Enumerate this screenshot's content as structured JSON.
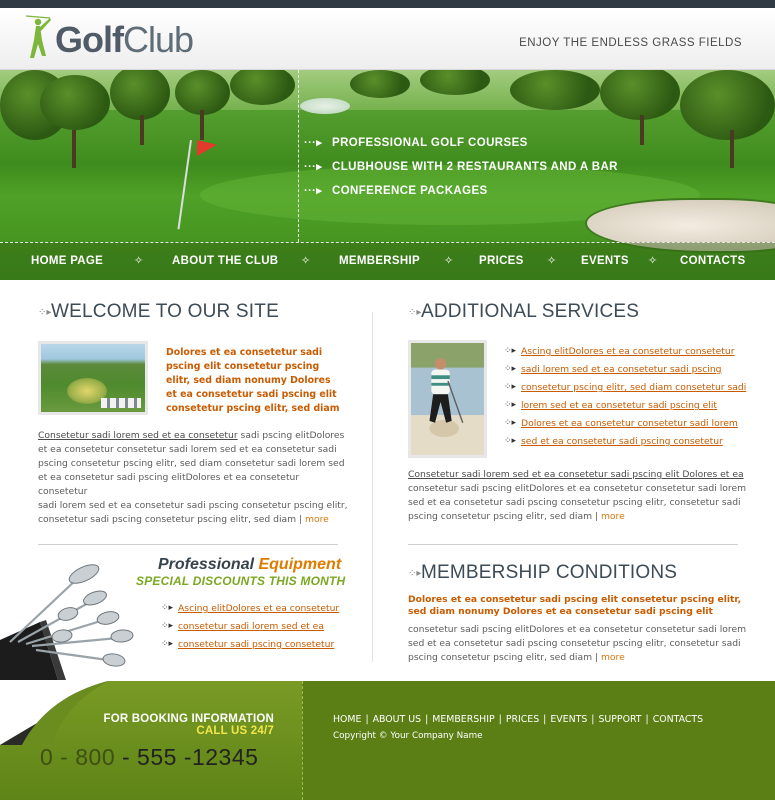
{
  "header": {
    "logo_part1": "Golf",
    "logo_part2": "Club",
    "tagline": "ENJOY THE ENDLESS GRASS FIELDS"
  },
  "banner": {
    "features": [
      "PROFESSIONAL GOLF COURSES",
      "CLUBHOUSE WITH 2 RESTAURANTS AND A BAR",
      "CONFERENCE PACKAGES"
    ]
  },
  "nav": {
    "items": [
      "HOME PAGE",
      "ABOUT THE CLUB",
      "MEMBERSHIP",
      "PRICES",
      "EVENTS",
      "CONTACTS"
    ]
  },
  "welcome": {
    "title": "WELCOME TO OUR SITE",
    "highlight_lines": [
      "Dolores et ea consetetur sadi",
      "pscing elit consetetur pscing",
      "elitr, sed diam nonumy Dolores",
      "et ea consetetur sadi pscing elit",
      "consetetur pscing elitr, sed diam"
    ],
    "body_link": "Consetetur sadi lorem sed  et ea consetetur",
    "body_lines": [
      " sadi pscing elitDolores",
      "et ea consetetur consetetur sadi lorem sed  et ea consetetur sadi",
      "pscing consetetur pscing elitr, sed diam consetetur sadi lorem sed",
      "et ea consetetur sadi pscing elitDolores et ea consetetur consetetur",
      "sadi lorem sed  et ea consetetur sadi pscing consetetur pscing elitr,",
      "consetetur sadi pscing consetetur pscing elitr, sed diam"
    ],
    "more": "more"
  },
  "equipment": {
    "title_part1": "Professional",
    "title_part2": "Equipment",
    "subtitle": "SPECIAL DISCOUNTS THIS MONTH",
    "links": [
      "Ascing elitDolores et ea consetetur",
      "consetetur sadi lorem sed  et ea",
      "consetetur sadi pscing consetetur "
    ]
  },
  "services": {
    "title": "ADDITIONAL SERVICES",
    "links": [
      "Ascing elitDolores et ea consetetur consetetur",
      "sadi lorem sed  et ea consetetur sadi pscing",
      "consetetur pscing elitr, sed diam consetetur sadi",
      "lorem sed  et ea consetetur sadi pscing elit",
      "Dolores et ea consetetur consetetur sadi lorem",
      "sed  et ea consetetur sadi pscing consetetur"
    ],
    "body_lines": [
      "Consetetur sadi lorem sed  et ea consetetur sadi pscing elit Dolores et ea",
      "consetetur sadi pscing elitDolores et ea consetetur consetetur sadi lorem",
      "sed  et ea consetetur sadi pscing consetetur pscing elitr, consetetur sadi",
      "pscing consetetur pscing elitr, sed diam"
    ],
    "more": "more"
  },
  "membership": {
    "title": "MEMBERSHIP CONDITIONS",
    "highlight_lines": [
      "Dolores et ea consetetur sadi pscing elit consetetur pscing elitr,",
      "sed diam nonumy Dolores et ea consetetur sadi pscing elit"
    ],
    "body_lines": [
      "consetetur sadi pscing elitDolores et ea consetetur consetetur sadi lorem",
      "sed  et ea consetetur sadi pscing consetetur pscing elitr, consetetur sadi",
      "pscing consetetur pscing elitr, sed diam"
    ],
    "more": "more"
  },
  "footer": {
    "booking_line1": "FOR BOOKING INFORMATION",
    "booking_line2": "CALL US 24/7",
    "phone_prefix": "0 - 800",
    "phone_number": " - 555 -12345",
    "links": [
      "HOME",
      "ABOUT US",
      "MEMBERSHIP",
      "PRICES",
      "EVENTS",
      "SUPPORT",
      "CONTACTS"
    ],
    "copyright": "Copyright © Your Company Name"
  },
  "colors": {
    "accent_orange": "#c95b00",
    "footer_green": "#5b7f15",
    "heading_slate": "#3d4b56"
  }
}
